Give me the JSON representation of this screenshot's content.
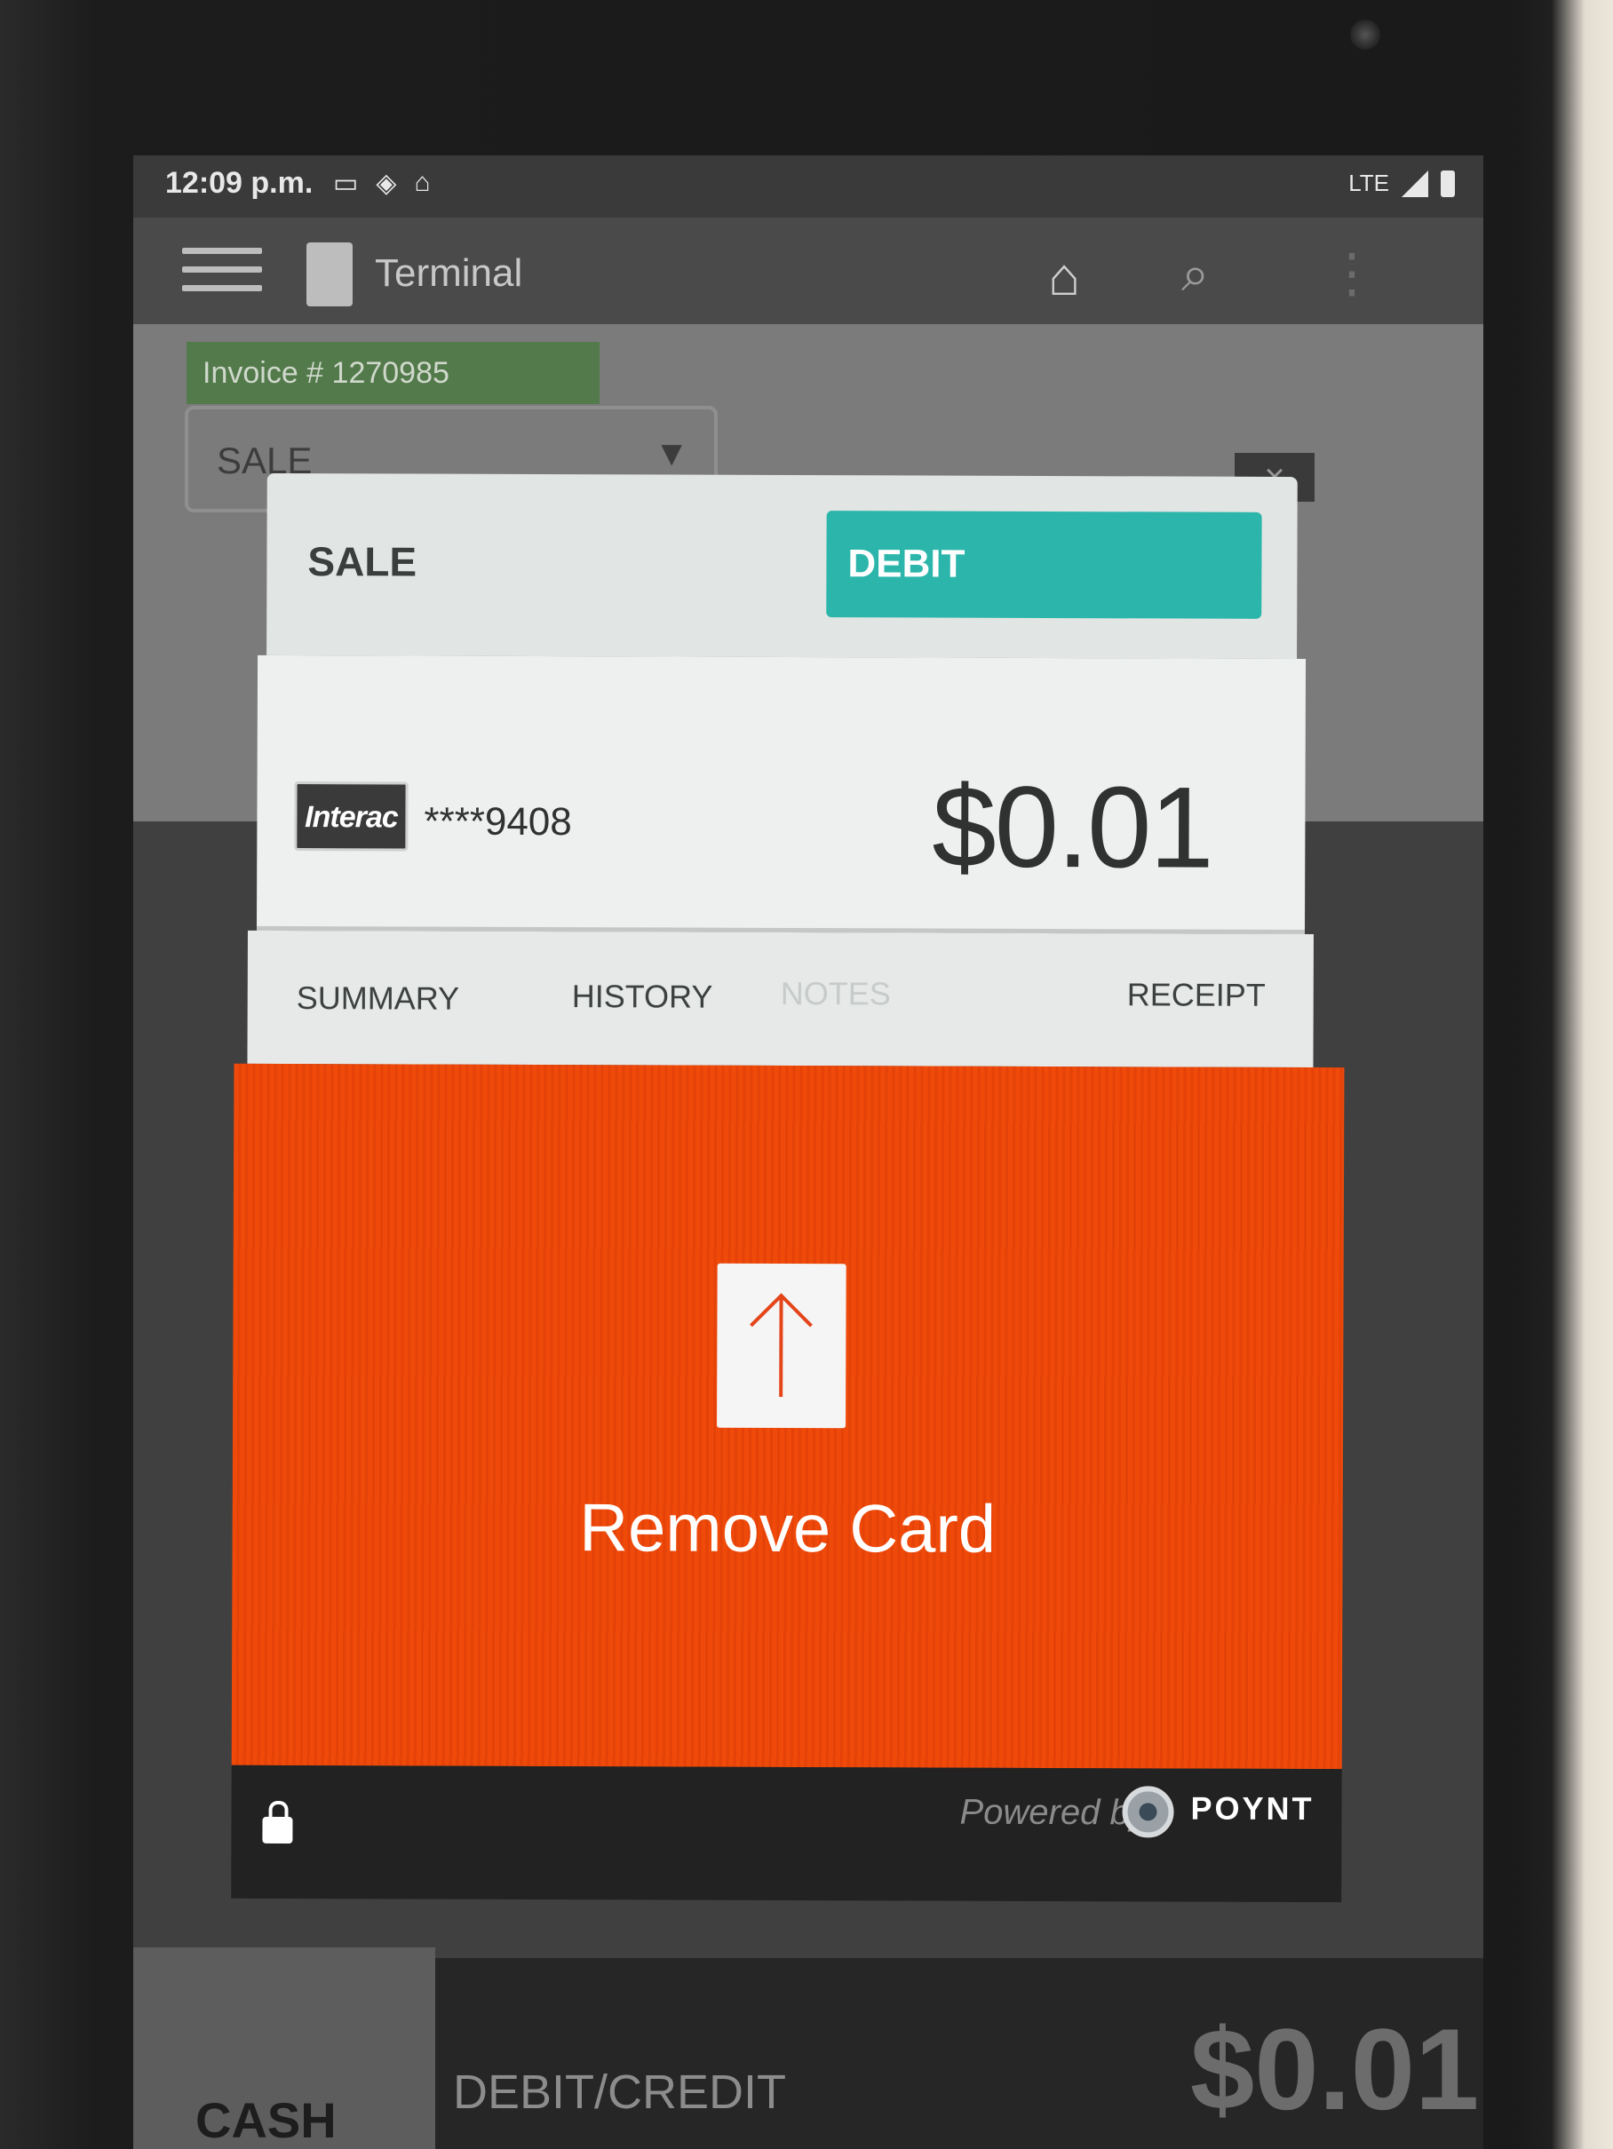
{
  "status_bar": {
    "time": "12:09 p.m.",
    "network": "LTE"
  },
  "app_bar": {
    "title": "Terminal"
  },
  "background": {
    "invoice_label": "Invoice # 1270985",
    "transaction_type": "SALE",
    "clear_symbol": "×",
    "bottom_tabs": {
      "cash": "CASH",
      "debit_credit": "DEBIT/CREDIT"
    },
    "total": "$0.01"
  },
  "dialog": {
    "transaction_type": "SALE",
    "payment_type": "DEBIT",
    "card": {
      "brand_logo_text": "Interac",
      "masked_number": "****9408"
    },
    "amount": "$0.01",
    "tabs": [
      {
        "label": "SUMMARY",
        "enabled": true
      },
      {
        "label": "HISTORY",
        "enabled": true
      },
      {
        "label": "NOTES",
        "enabled": false
      },
      {
        "label": "RECEIPT",
        "enabled": true
      }
    ],
    "alert": {
      "message": "Remove Card",
      "color": "#ef4a0a"
    },
    "footer": {
      "powered_by": "Powered by",
      "brand": "POYNT"
    }
  },
  "icons": [
    "menu-icon",
    "home-icon",
    "search-icon",
    "more-vert-icon",
    "lock-icon",
    "arrow-up-icon",
    "signal-icon",
    "battery-icon"
  ],
  "colors": {
    "debit_badge": "#2cb6ab",
    "alert": "#ef4a0a",
    "invoice_badge": "#537a4b"
  }
}
